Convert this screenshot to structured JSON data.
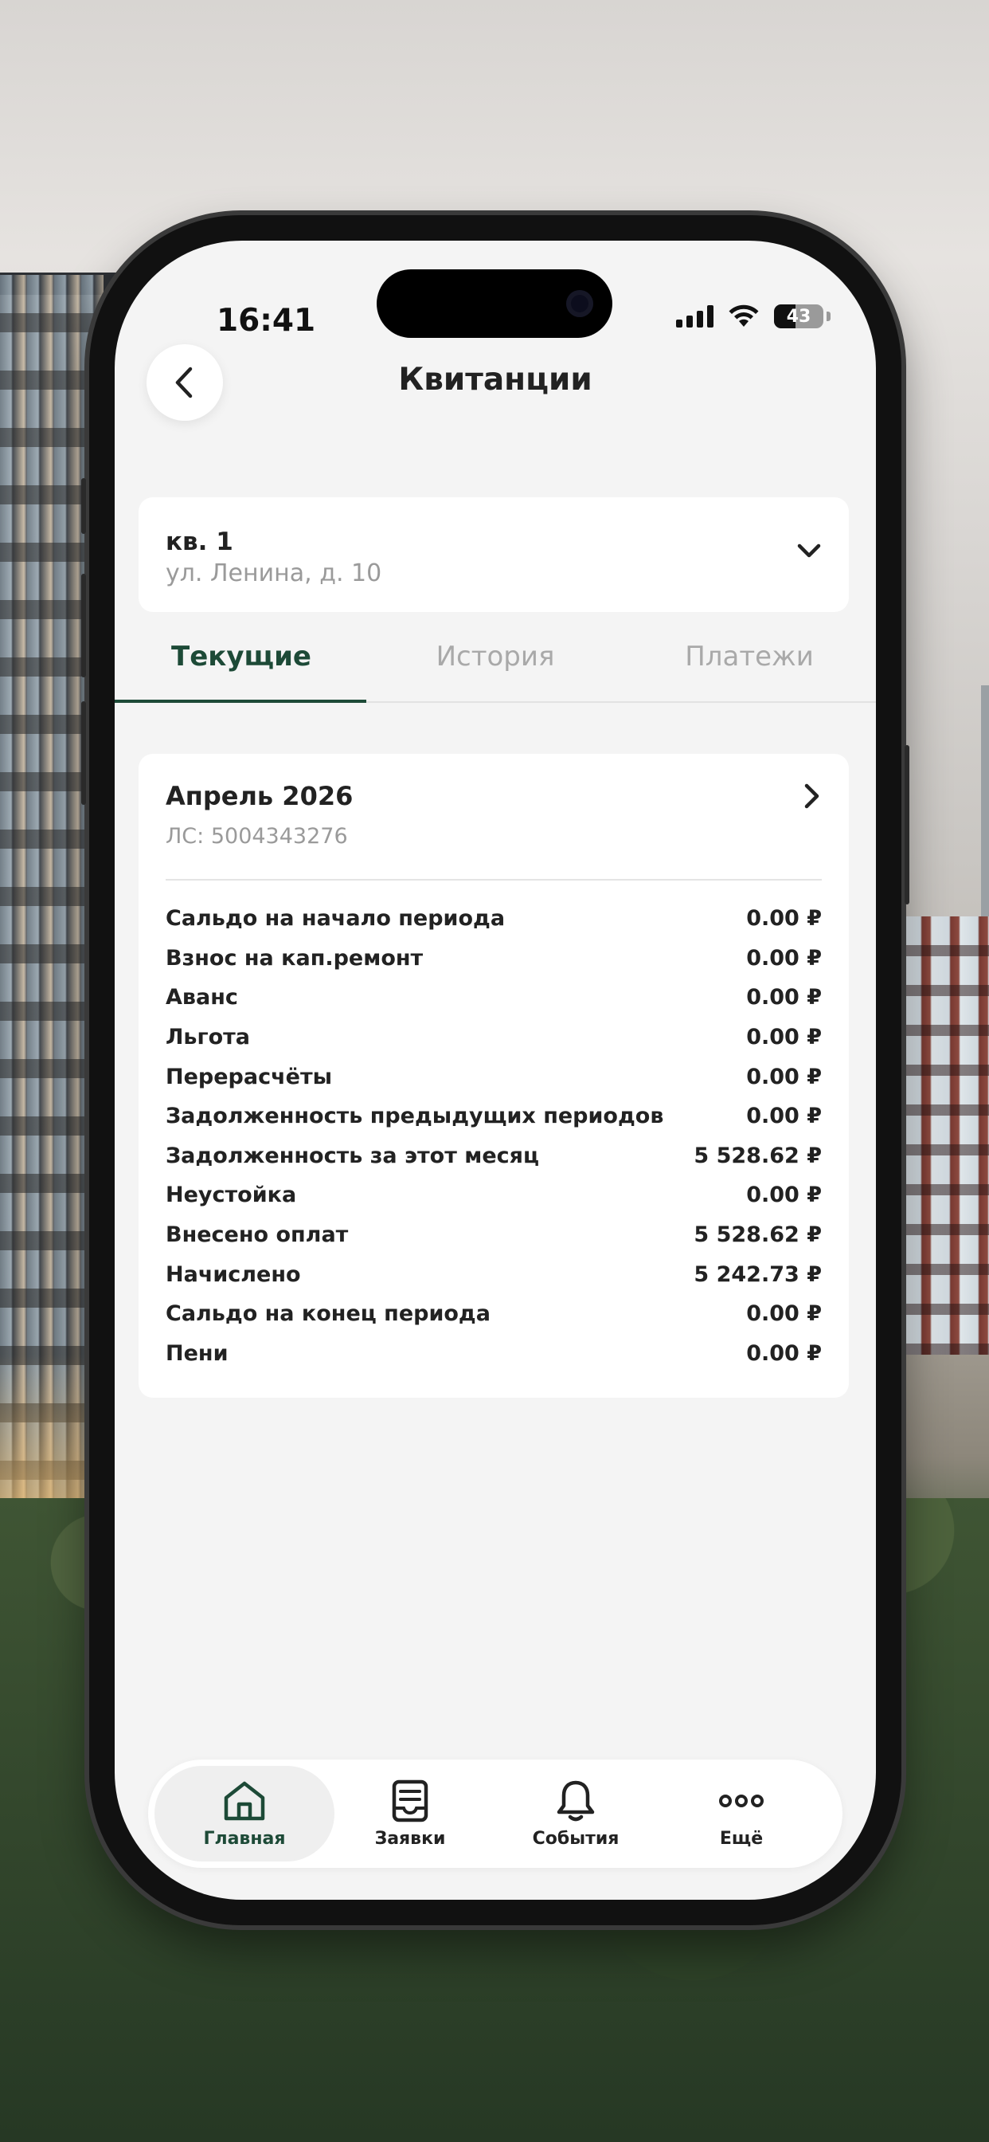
{
  "status_bar": {
    "time": "16:41",
    "battery": "43",
    "battery_level": 0.43
  },
  "header": {
    "title": "Квитанции"
  },
  "address": {
    "apartment": "кв. 1",
    "street": "ул. Ленина, д. 10"
  },
  "tabs": [
    {
      "label": "Текущие",
      "active": true
    },
    {
      "label": "История",
      "active": false
    },
    {
      "label": "Платежи",
      "active": false
    }
  ],
  "statement": {
    "month": "Апрель 2026",
    "account": "ЛС: 5004343276",
    "rows": [
      {
        "label": "Сальдо на начало периода",
        "value": "0.00 ₽"
      },
      {
        "label": "Взнос на кап.ремонт",
        "value": "0.00 ₽"
      },
      {
        "label": "Аванс",
        "value": "0.00 ₽"
      },
      {
        "label": "Льгота",
        "value": "0.00 ₽"
      },
      {
        "label": "Перерасчёты",
        "value": "0.00 ₽"
      },
      {
        "label": "Задолженность предыдущих периодов",
        "value": "0.00 ₽"
      },
      {
        "label": "Задолженность за этот месяц",
        "value": "5 528.62 ₽"
      },
      {
        "label": "Неустойка",
        "value": "0.00 ₽"
      },
      {
        "label": "Внесено оплат",
        "value": "5 528.62 ₽"
      },
      {
        "label": "Начислено",
        "value": "5 242.73 ₽"
      },
      {
        "label": "Сальдо на конец периода",
        "value": "0.00 ₽"
      },
      {
        "label": "Пени",
        "value": "0.00 ₽"
      }
    ]
  },
  "bottom_nav": [
    {
      "label": "Главная",
      "icon": "home-icon",
      "active": true
    },
    {
      "label": "Заявки",
      "icon": "requests-icon",
      "active": false
    },
    {
      "label": "События",
      "icon": "bell-icon",
      "active": false
    },
    {
      "label": "Ещё",
      "icon": "more-icon",
      "active": false
    }
  ],
  "colors": {
    "accent": "#1d4a37",
    "muted": "#9a9a9a",
    "screen_bg": "#f4f4f4"
  }
}
